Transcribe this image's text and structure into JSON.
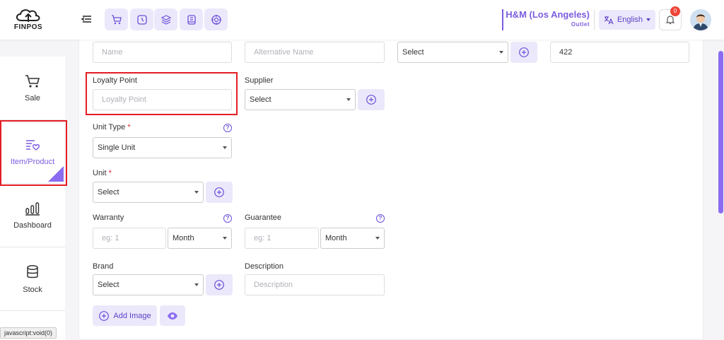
{
  "brand": {
    "logo_text": "FINPOS"
  },
  "header": {
    "quick_icons": [
      "cart-icon",
      "clock-icon",
      "layers-icon",
      "book-icon",
      "target-icon"
    ],
    "outlet": {
      "name": "H&M (Los Angeles)",
      "type": "Outlet"
    },
    "language": "English",
    "notifications_count": "0"
  },
  "sidebar": {
    "items": [
      {
        "label": "Sale",
        "icon": "cart-icon"
      },
      {
        "label": "Item/Product",
        "icon": "product-list-icon",
        "active": true
      },
      {
        "label": "Dashboard",
        "icon": "bar-chart-icon"
      },
      {
        "label": "Stock",
        "icon": "database-icon"
      }
    ]
  },
  "form": {
    "name_placeholder": "Name",
    "alt_name_placeholder": "Alternative Name",
    "category_select": "Select",
    "code_value": "422",
    "loyalty_label": "Loyalty Point",
    "loyalty_placeholder": "Loyalty Point",
    "supplier_label": "Supplier",
    "supplier_select": "Select",
    "unit_type_label": "Unit Type",
    "unit_type_value": "Single Unit",
    "unit_label": "Unit",
    "unit_select": "Select",
    "warranty_label": "Warranty",
    "warranty_placeholder": "eg: 1",
    "warranty_period": "Month",
    "guarantee_label": "Guarantee",
    "guarantee_placeholder": "eg: 1",
    "guarantee_period": "Month",
    "brand_label": "Brand",
    "brand_select": "Select",
    "description_label": "Description",
    "description_placeholder": "Description",
    "required_mark": "*",
    "help_mark": "?",
    "add_image_label": "Add Image"
  },
  "statusbar": "javascript:void(0)",
  "colors": {
    "accent": "#7c5ce0",
    "accent_light": "#ece8fb",
    "highlight": "#e31e24"
  }
}
